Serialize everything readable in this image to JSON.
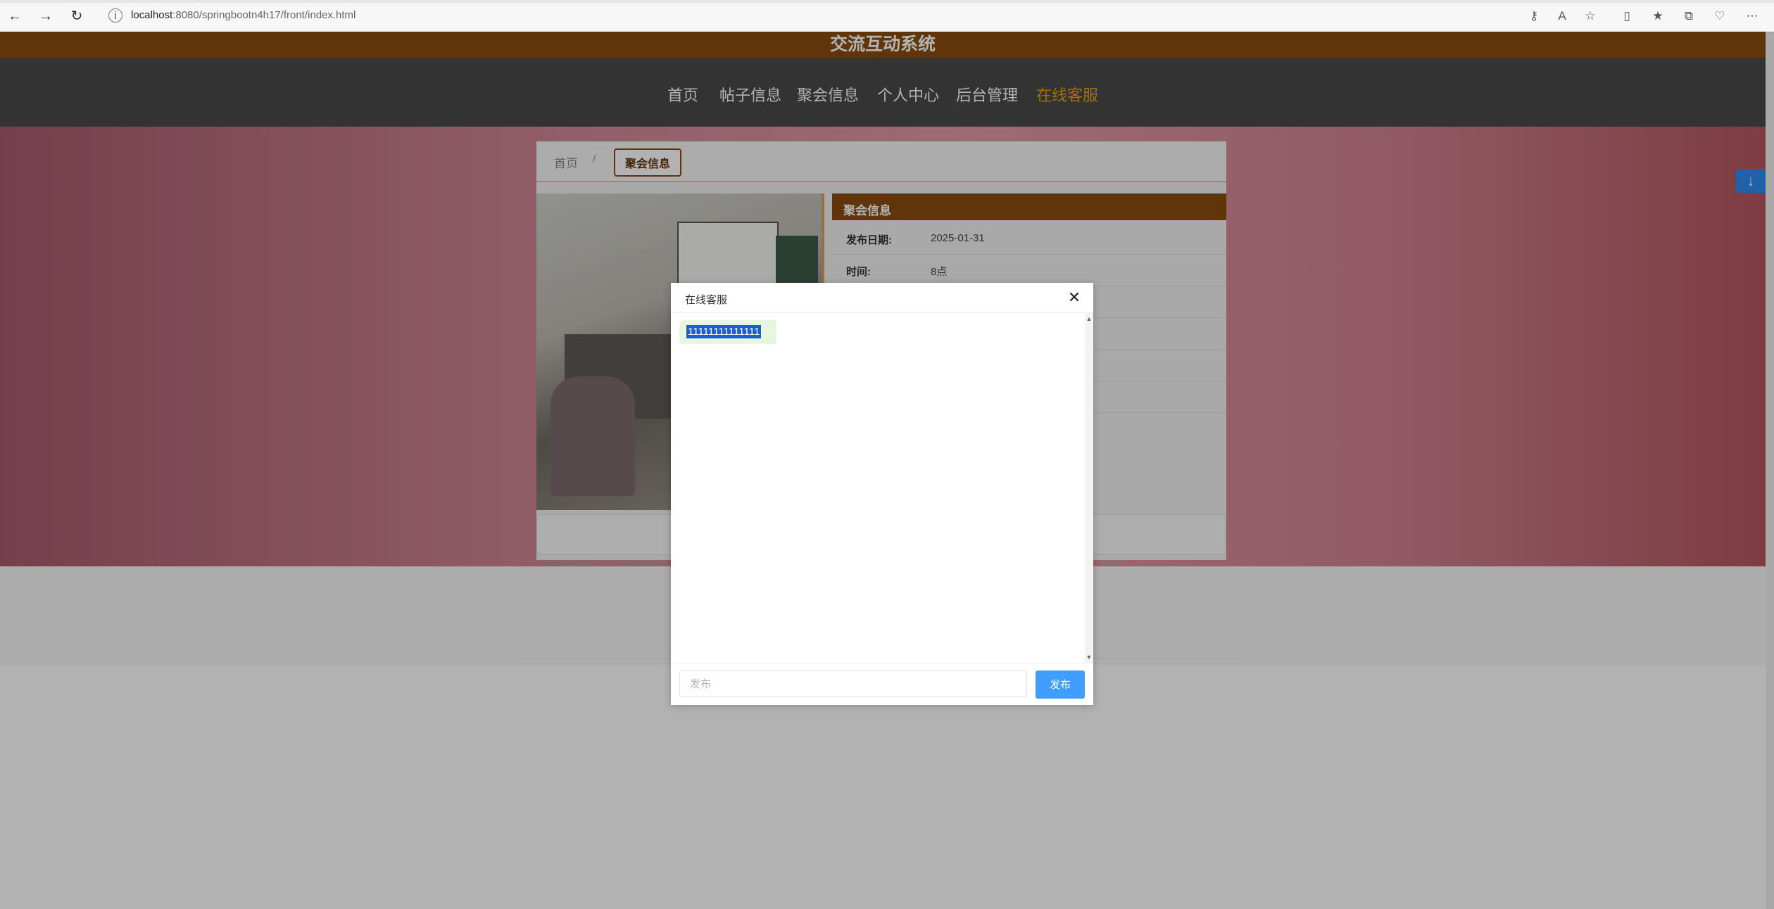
{
  "browser": {
    "url_host": "localhost",
    "url_path": ":8080/springbootn4h17/front/index.html"
  },
  "site": {
    "title": "交流互动系统",
    "nav": [
      {
        "label": "首页"
      },
      {
        "label": "帖子信息"
      },
      {
        "label": "聚会信息"
      },
      {
        "label": "个人中心"
      },
      {
        "label": "后台管理"
      },
      {
        "label": "在线客服"
      }
    ]
  },
  "breadcrumb": {
    "home": "首页",
    "separator": "/",
    "current": "聚会信息"
  },
  "detail": {
    "section_title": "聚会信息",
    "rows": [
      {
        "key": "发布日期:",
        "value": "2025-01-31"
      },
      {
        "key": "时间:",
        "value": "8点"
      }
    ]
  },
  "dialog": {
    "title": "在线客服",
    "messages": [
      {
        "text": "11111111111111"
      }
    ],
    "input_placeholder": "发布",
    "send_label": "发布"
  },
  "colors": {
    "accent_brown": "#8a4c0e",
    "active_nav": "#e8a317",
    "send_button": "#409eff"
  }
}
